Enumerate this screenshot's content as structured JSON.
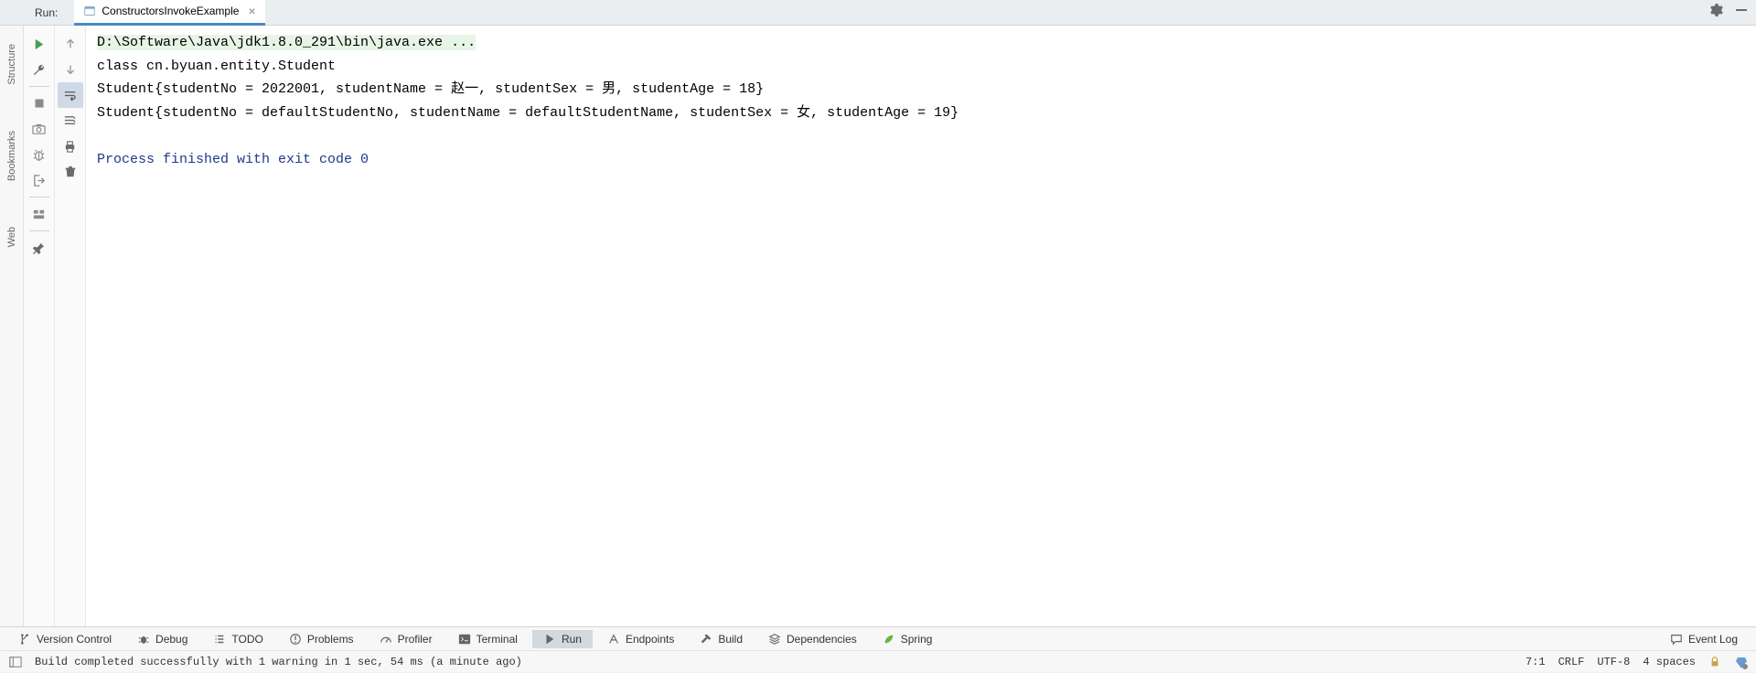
{
  "topBar": {
    "runLabel": "Run:",
    "tabName": "ConstructorsInvokeExample"
  },
  "console": {
    "cmdLine": "D:\\Software\\Java\\jdk1.8.0_291\\bin\\java.exe ...",
    "line2": "class cn.byuan.entity.Student",
    "line3": "Student{studentNo = 2022001, studentName = 赵一, studentSex = 男, studentAge = 18}",
    "line4": "Student{studentNo = defaultStudentNo, studentName = defaultStudentName, studentSex = 女, studentAge = 19}",
    "exitLine": "Process finished with exit code 0"
  },
  "leftSidebar": {
    "structure": "Structure",
    "bookmarks": "Bookmarks",
    "web": "Web"
  },
  "bottomTools": {
    "versionControl": "Version Control",
    "debug": "Debug",
    "todo": "TODO",
    "problems": "Problems",
    "profiler": "Profiler",
    "terminal": "Terminal",
    "run": "Run",
    "endpoints": "Endpoints",
    "build": "Build",
    "dependencies": "Dependencies",
    "spring": "Spring",
    "eventLog": "Event Log"
  },
  "statusBar": {
    "buildMsg": "Build completed successfully with 1 warning in 1 sec, 54 ms (a minute ago)",
    "cursor": "7:1",
    "lineSep": "CRLF",
    "encoding": "UTF-8",
    "indent": "4 spaces"
  }
}
